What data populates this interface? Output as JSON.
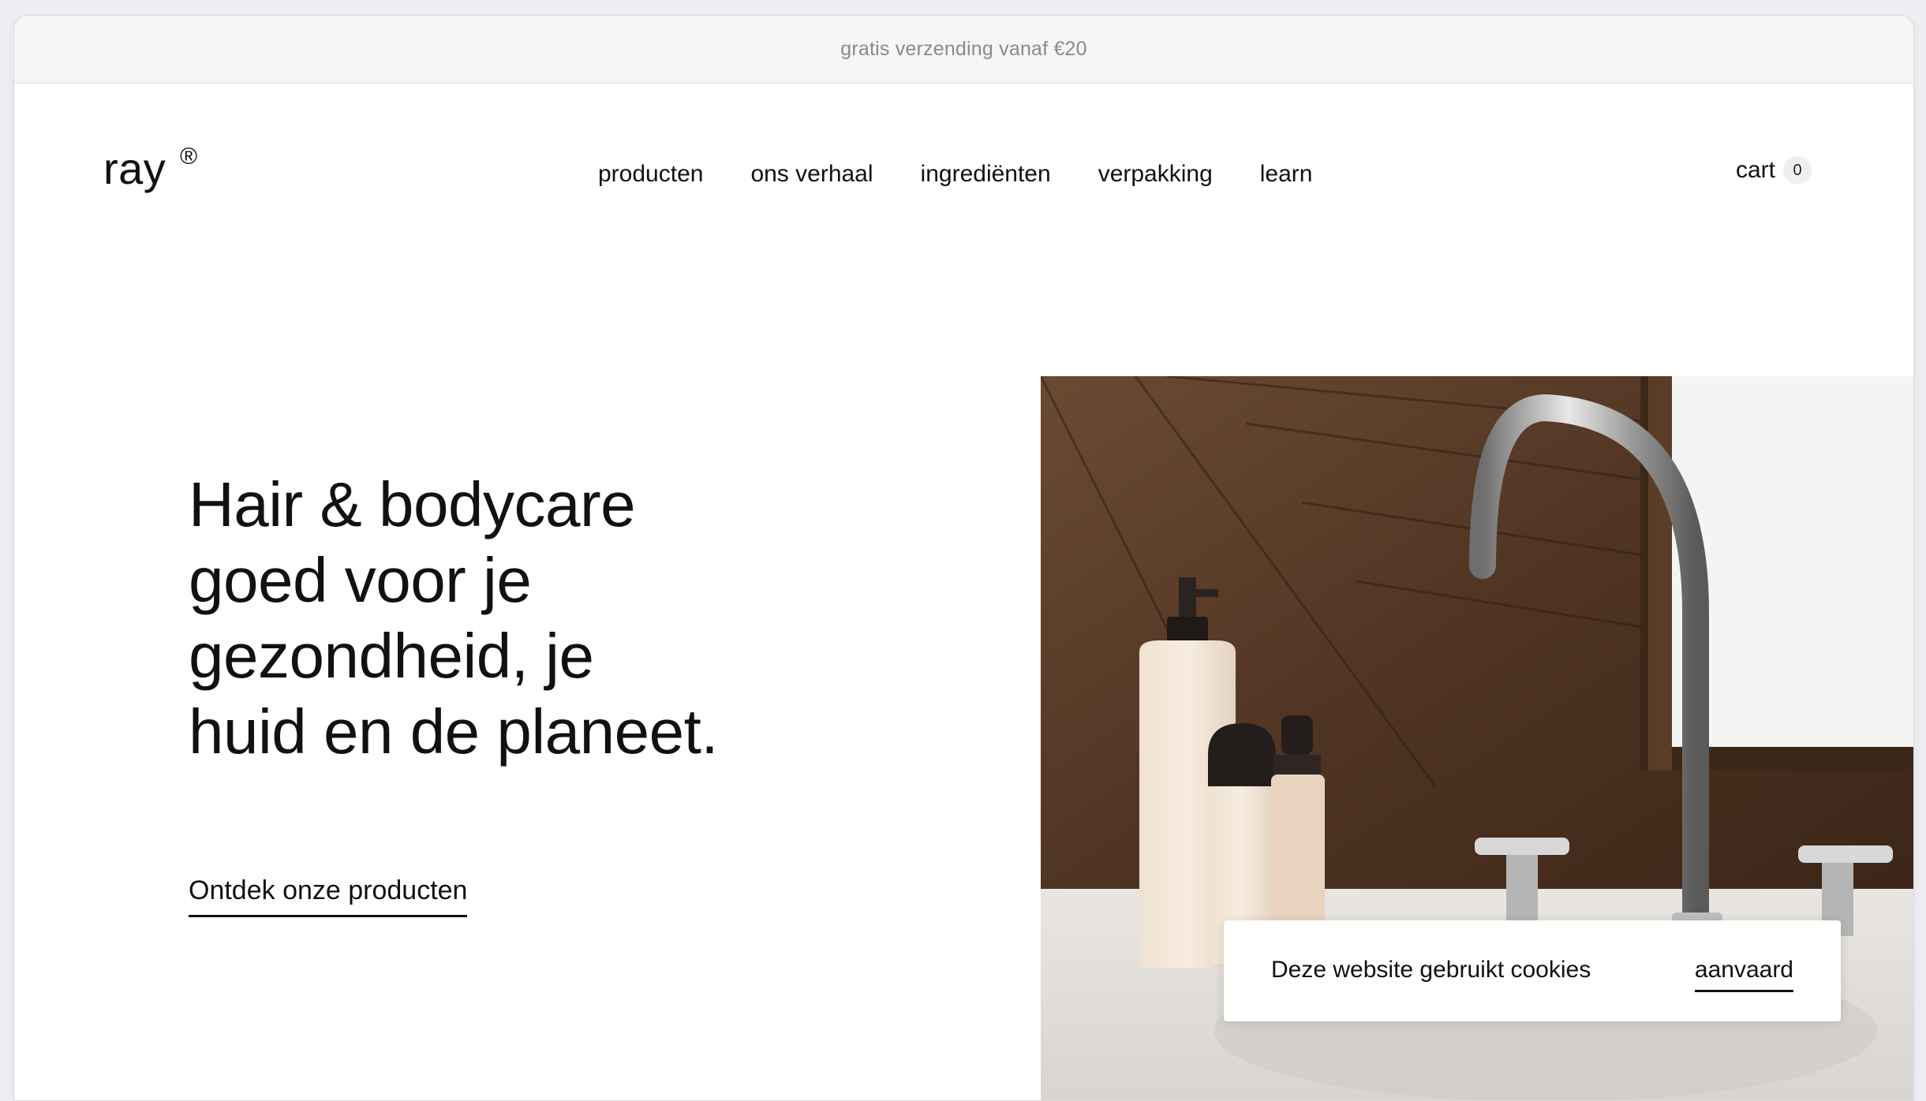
{
  "announcement": {
    "text": "gratis verzending vanaf €20"
  },
  "header": {
    "logo": "ray",
    "logo_mark": "®",
    "nav": [
      {
        "label": "producten"
      },
      {
        "label": "ons verhaal"
      },
      {
        "label": "ingrediënten"
      },
      {
        "label": "verpakking"
      },
      {
        "label": "learn"
      }
    ],
    "cart_label": "cart",
    "cart_count": "0"
  },
  "hero": {
    "title_lines": [
      "Hair & bodycare",
      "goed voor je",
      "gezondheid, je",
      "huid en de planeet."
    ],
    "cta_label": "Ontdek onze producten",
    "image_subject": "bathroom-sink-with-ray-bottles"
  },
  "cookie": {
    "text": "Deze website gebruikt cookies",
    "accept_label": "aanvaard"
  },
  "colors": {
    "text": "#111111",
    "announce_bg": "#f6f6f6",
    "announce_text": "#8a8a8a",
    "badge_bg": "#efefef"
  }
}
